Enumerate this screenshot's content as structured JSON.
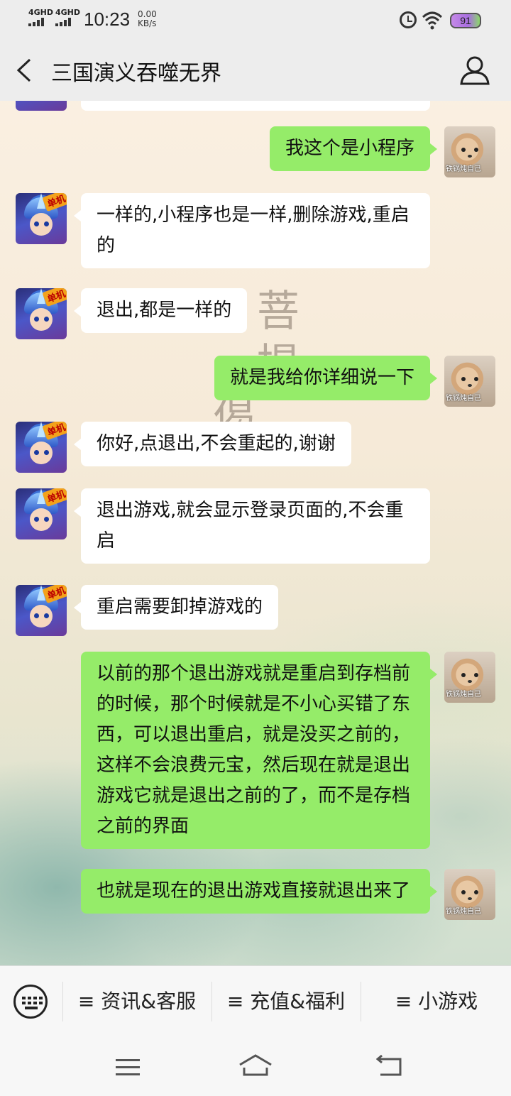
{
  "status": {
    "net1": "4GHD",
    "net2": "4GHD",
    "time": "10:23",
    "speed_value": "0.00",
    "speed_unit": "KB/s",
    "battery": "91"
  },
  "header": {
    "title": "三国演义吞噬无界"
  },
  "messages": [
    {
      "from": "me",
      "text": "我这个是小程序"
    },
    {
      "from": "them",
      "text": "一样的,小程序也是一样,删除游戏,重启的"
    },
    {
      "from": "them",
      "text": "退出,都是一样的"
    },
    {
      "from": "me",
      "text": "就是我给你详细说一下"
    },
    {
      "from": "them",
      "text": "你好,点退出,不会重起的,谢谢"
    },
    {
      "from": "them",
      "text": "退出游戏,就会显示登录页面的,不会重启"
    },
    {
      "from": "them",
      "text": "重启需要卸掉游戏的"
    },
    {
      "from": "me",
      "text": "以前的那个退出游戏就是重启到存档前的时候，那个时候就是不小心买错了东西，可以退出重启，就是没买之前的，这样不会浪费元宝，然后现在就是退出游戏它就是退出之前的了，而不是存档之前的界面"
    },
    {
      "from": "me",
      "text": "也就是现在的退出游戏直接就退出来了"
    }
  ],
  "avatars": {
    "game_tag": "单机",
    "me_caption": "铁锅炖自己"
  },
  "background_text": [
    "菩",
    "提",
    "偈"
  ],
  "menu": {
    "items": [
      "≡ 资讯&客服",
      "≡ 充值&福利",
      "≡ 小游戏"
    ]
  },
  "colors": {
    "bubble_out": "#95ec69",
    "bubble_in": "#ffffff",
    "header_bg": "#ededed"
  }
}
